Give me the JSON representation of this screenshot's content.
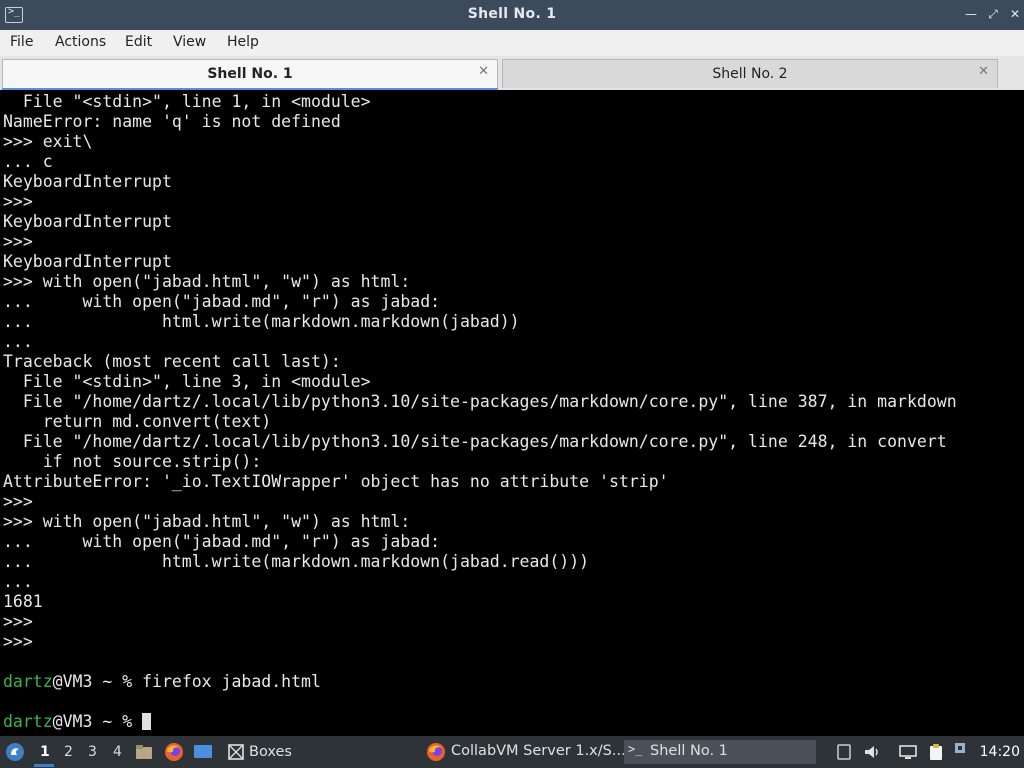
{
  "window": {
    "title": "Shell No. 1"
  },
  "menu": [
    "File",
    "Actions",
    "Edit",
    "View",
    "Help"
  ],
  "tabs": [
    {
      "label": "Shell No. 1",
      "active": true
    },
    {
      "label": "Shell No. 2",
      "active": false
    }
  ],
  "terminal": {
    "lines": [
      "  File \"<stdin>\", line 1, in <module>",
      "NameError: name 'q' is not defined",
      ">>> exit\\",
      "... c",
      "KeyboardInterrupt",
      ">>> ",
      "KeyboardInterrupt",
      ">>> ",
      "KeyboardInterrupt",
      ">>> with open(\"jabad.html\", \"w\") as html:",
      "...     with open(\"jabad.md\", \"r\") as jabad:",
      "...             html.write(markdown.markdown(jabad))",
      "... ",
      "Traceback (most recent call last):",
      "  File \"<stdin>\", line 3, in <module>",
      "  File \"/home/dartz/.local/lib/python3.10/site-packages/markdown/core.py\", line 387, in markdown",
      "    return md.convert(text)",
      "  File \"/home/dartz/.local/lib/python3.10/site-packages/markdown/core.py\", line 248, in convert",
      "    if not source.strip():",
      "AttributeError: '_io.TextIOWrapper' object has no attribute 'strip'",
      ">>> ",
      ">>> with open(\"jabad.html\", \"w\") as html:",
      "...     with open(\"jabad.md\", \"r\") as jabad:",
      "...             html.write(markdown.markdown(jabad.read()))",
      "... ",
      "1681",
      ">>> ",
      ">>> "
    ],
    "prompt_user": "dartz",
    "prompt_rest": "@VM3 ~ % ",
    "command": "firefox jabad.html"
  },
  "taskbar": {
    "workspaces": [
      "1",
      "2",
      "3",
      "4"
    ],
    "active_workspace": "1",
    "boxes_label": "Boxes",
    "firefox_window": "CollabVM Server 1.x/S...",
    "terminal_window": "Shell No. 1",
    "clock": "14:20",
    "icons": [
      "start-menu-icon",
      "file-manager-icon",
      "firefox-icon",
      "show-desktop-icon",
      "boxes-icon",
      "tray-app-icon",
      "volume-icon",
      "display-icon",
      "clipboard-icon",
      "network-icon"
    ]
  }
}
